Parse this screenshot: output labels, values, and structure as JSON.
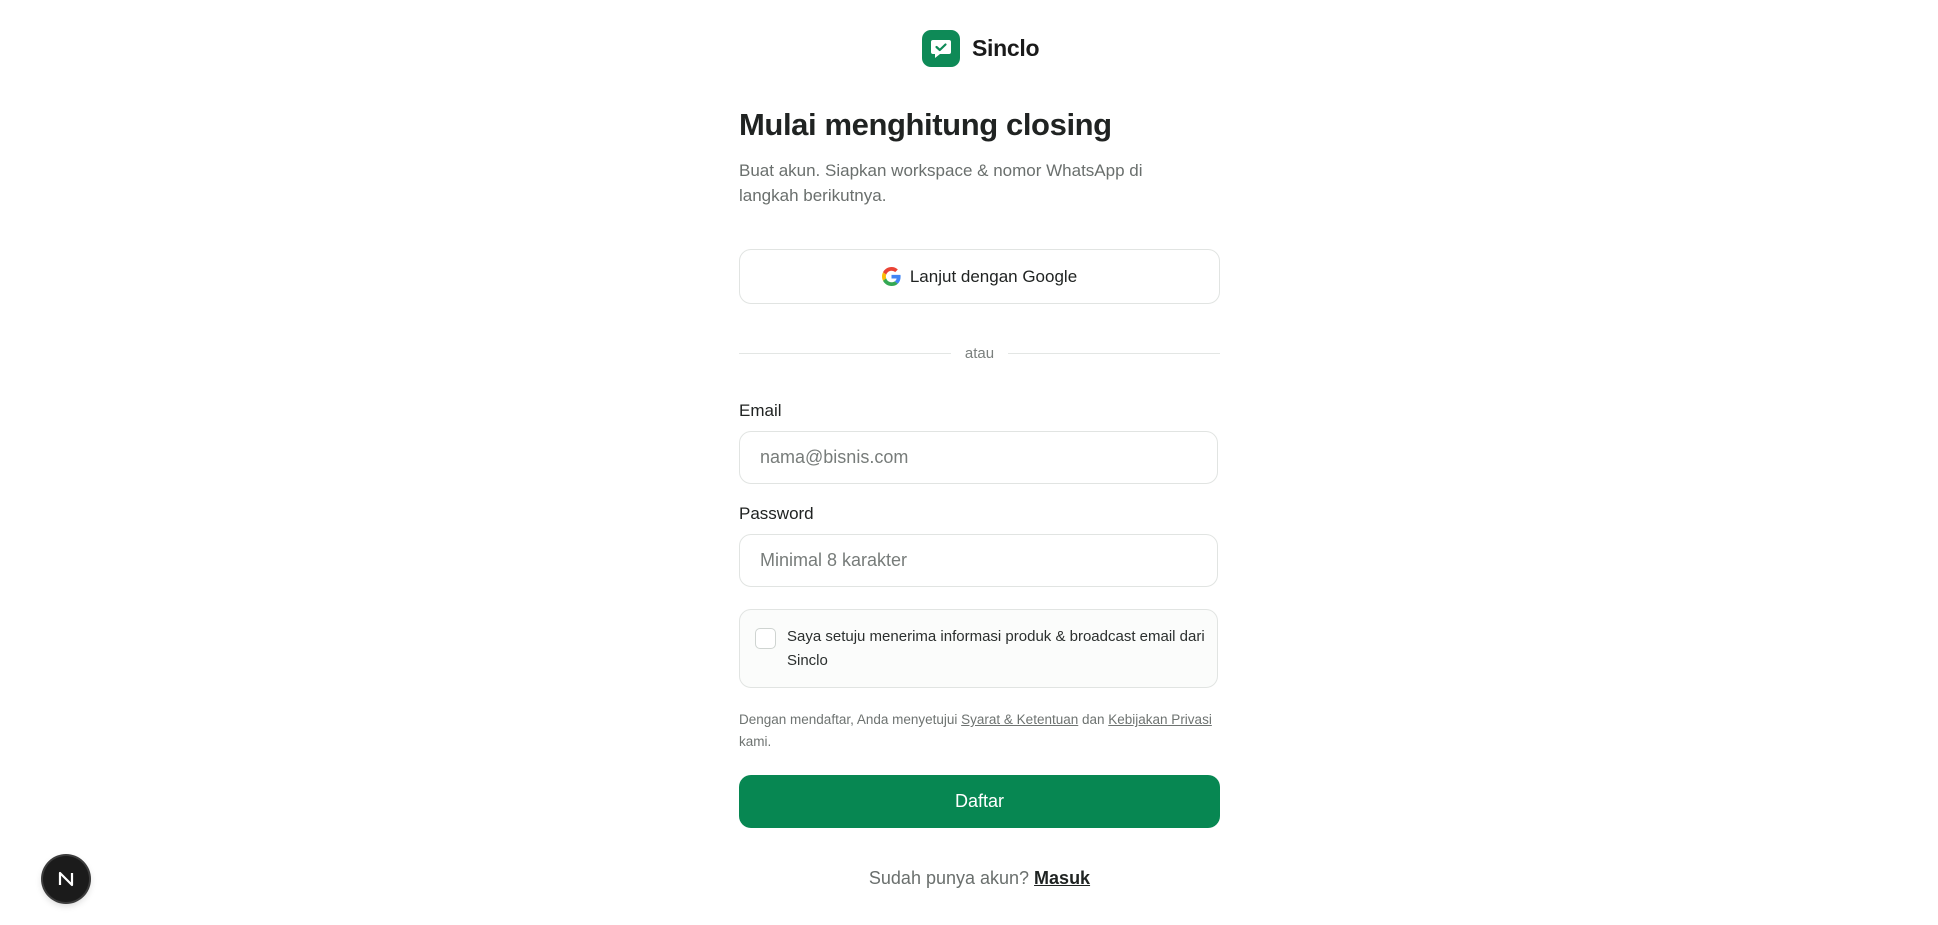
{
  "brand": {
    "name": "Sinclo"
  },
  "page": {
    "title": "Mulai menghitung closing",
    "subtitle": "Buat akun. Siapkan workspace & nomor WhatsApp di langkah berikutnya."
  },
  "google_button": {
    "label": "Lanjut dengan Google",
    "icon": "google-icon"
  },
  "divider": {
    "text": "atau"
  },
  "email": {
    "label": "Email",
    "placeholder": "nama@bisnis.com",
    "value": ""
  },
  "password": {
    "label": "Password",
    "placeholder": "Minimal 8 karakter",
    "value": ""
  },
  "consent": {
    "text": "Saya setuju menerima informasi produk & broadcast email dari Sinclo",
    "checked": false
  },
  "legal": {
    "prefix": "Dengan mendaftar, Anda menyetujui ",
    "terms_link": "Syarat & Ketentuan",
    "middle": " dan ",
    "privacy_link": "Kebijakan Privasi",
    "suffix": " kami."
  },
  "submit": {
    "label": "Daftar"
  },
  "signin": {
    "prompt": "Sudah punya akun? ",
    "link": "Masuk"
  },
  "dev_badge": {
    "letter": "N",
    "icon": "nextjs-icon"
  },
  "colors": {
    "primary": "#078752",
    "border": "#e1e4e2",
    "muted_text": "#6a6f6d"
  }
}
